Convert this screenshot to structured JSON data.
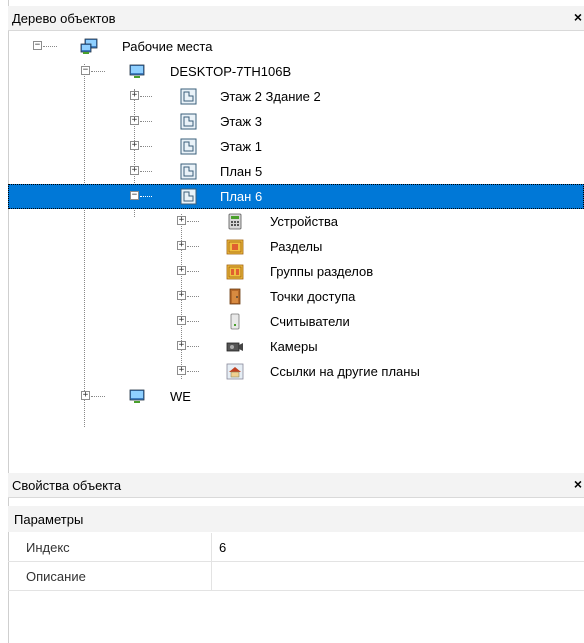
{
  "tree_panel": {
    "title": "Дерево объектов",
    "close": "×",
    "nodes": [
      {
        "label": "Рабочие места",
        "toggle": "−",
        "icon": "workstation-icon"
      },
      {
        "label": "DESKTOP-7TH106B",
        "toggle": "−",
        "icon": "computer-icon"
      },
      {
        "label": "Этаж 2 Здание 2",
        "toggle": "+",
        "icon": "plan-icon"
      },
      {
        "label": "Этаж 3",
        "toggle": "+",
        "icon": "plan-icon"
      },
      {
        "label": "Этаж 1",
        "toggle": "+",
        "icon": "plan-icon"
      },
      {
        "label": "План 5",
        "toggle": "+",
        "icon": "plan-icon"
      },
      {
        "label": "План 6",
        "toggle": "−",
        "icon": "plan-icon",
        "selected": true
      },
      {
        "label": "Устройства",
        "toggle": "+",
        "icon": "devices-icon"
      },
      {
        "label": "Разделы",
        "toggle": "+",
        "icon": "sections-icon"
      },
      {
        "label": "Группы разделов",
        "toggle": "+",
        "icon": "section-groups-icon"
      },
      {
        "label": "Точки доступа",
        "toggle": "+",
        "icon": "door-icon"
      },
      {
        "label": "Считыватели",
        "toggle": "+",
        "icon": "reader-icon"
      },
      {
        "label": "Камеры",
        "toggle": "+",
        "icon": "camera-icon"
      },
      {
        "label": "Ссылки на другие планы",
        "toggle": "+",
        "icon": "house-link-icon"
      },
      {
        "label": "WE",
        "toggle": "+",
        "icon": "computer-icon"
      }
    ]
  },
  "properties_panel": {
    "title": "Свойства объекта",
    "close": "×",
    "section": "Параметры",
    "rows": [
      {
        "name": "Индекс",
        "value": "6"
      },
      {
        "name": "Описание",
        "value": ""
      }
    ]
  },
  "colors": {
    "selection": "#0078d7",
    "header_bg": "#f3f3f3"
  }
}
